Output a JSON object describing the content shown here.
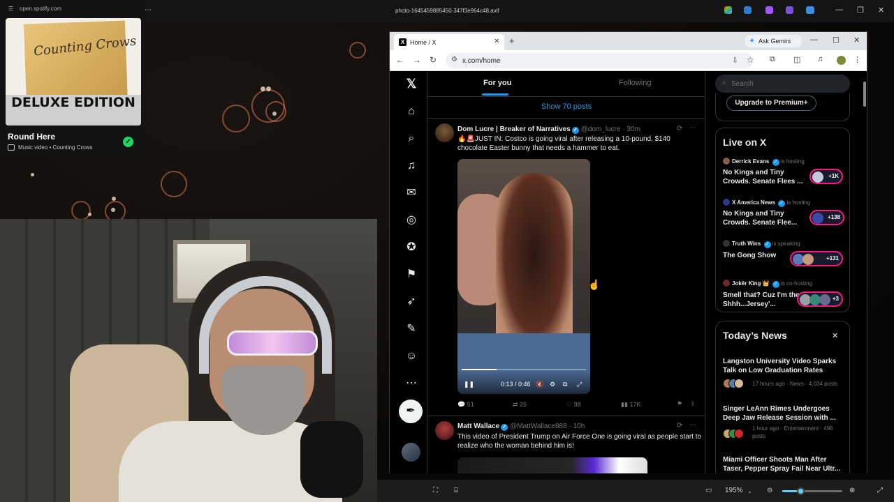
{
  "system_bar": {
    "spotify_url": "open.spotify.com",
    "image_filename": "photo-1645459885450-347f3e964c48.avif"
  },
  "spotify": {
    "url": "open.spotify.com",
    "cover_script": "Counting Crows",
    "cover_edition": "DELUXE EDITION",
    "track_title": "Round Here",
    "subtitle": "Music video • Counting Crows",
    "check_glyph": "✓"
  },
  "viewer_bar": {
    "zoom": "195%"
  },
  "browser": {
    "tab_title": "Home / X",
    "new_tab_glyph": "+",
    "gemini_label": "Ask Gemini",
    "url": "x.com/home"
  },
  "x": {
    "tabs": {
      "for_you": "For you",
      "following": "Following"
    },
    "show_posts": "Show 70 posts",
    "post1": {
      "name": "Dom Lucre | Breaker of Narratives",
      "handle": "@dom_lucre · 30m",
      "text": "🔥🚨JUST IN: Costco  is going viral after releasing a 10-pound, $140 chocolate Easter bunny  that needs a hammer to eat.",
      "video_time": "0:13 / 0:46",
      "replies": "51",
      "reposts": "25",
      "likes": "98",
      "views": "17K"
    },
    "post2": {
      "name": "Matt Wallace",
      "handle": "@MattWallace888 · 10h",
      "text": "This video of President Trump on Air Force One is going viral as people start to realize who the woman behind him is!"
    },
    "search_placeholder": "Search",
    "premium_label": "Upgrade to Premium+",
    "live": {
      "heading": "Live on X",
      "items": [
        {
          "host": "Derrick Evans",
          "status": "is hosting",
          "title": "No Kings and Tiny Crowds. Senate Flees ...",
          "count": "+1K"
        },
        {
          "host": "X America News",
          "status": "is hosting",
          "title": "No Kings and Tiny Crowds. Senate Flee...",
          "count": "+138"
        },
        {
          "host": "Truth Wins",
          "status": "is speaking",
          "title": "The Gong Show",
          "count": "+131"
        },
        {
          "host": "Jokêr Kïng 👑",
          "status": "is co-hosting",
          "title": "Smell that? Cuz I'm the Shhh...Jersey'...",
          "count": "+3"
        }
      ]
    },
    "news": {
      "heading": "Today’s News",
      "items": [
        {
          "title": "Langston University Video Sparks Talk on Low Graduation Rates",
          "meta": "17 hours ago · News · 4,034 posts"
        },
        {
          "title": "Singer LeAnn Rimes Undergoes Deep Jaw Release Session with ...",
          "meta": "1 hour ago · Entertainment · 496 posts"
        },
        {
          "title": "Miami Officer Shoots Man After Taser, Pepper Spray Fail Near Ultr...",
          "meta": ""
        }
      ]
    }
  },
  "colors": {
    "x_blue": "#1d9bf0",
    "live_pink": "#f91880",
    "spotify_green": "#1ed760"
  }
}
